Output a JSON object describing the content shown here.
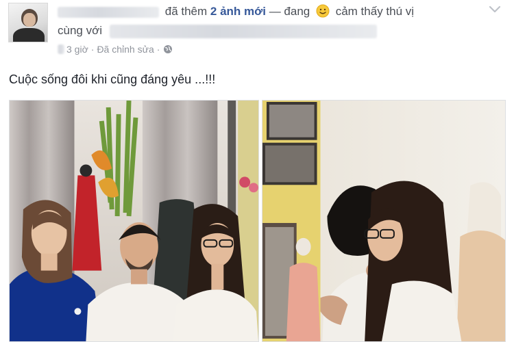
{
  "post": {
    "header": {
      "action_text": "đã thêm",
      "photo_count_link": "2 ảnh mới",
      "feeling_prefix": "— đang",
      "feeling_emoji": "smiling-face-icon",
      "feeling_text": "cảm thấy thú vị",
      "with_text": "cùng với"
    },
    "meta": {
      "time": "3 giờ",
      "separator": "·",
      "edited": "Đã chỉnh sửa",
      "privacy_icon": "globe-icon"
    },
    "caption": "Cuộc sống đôi khi cũng đáng yêu ...!!!",
    "photos": [
      {
        "description_icon": "group-photo"
      },
      {
        "description_icon": "hug-photo"
      }
    ]
  },
  "colors": {
    "link": "#365899",
    "text_secondary": "#4b4f56",
    "meta": "#90949c"
  }
}
